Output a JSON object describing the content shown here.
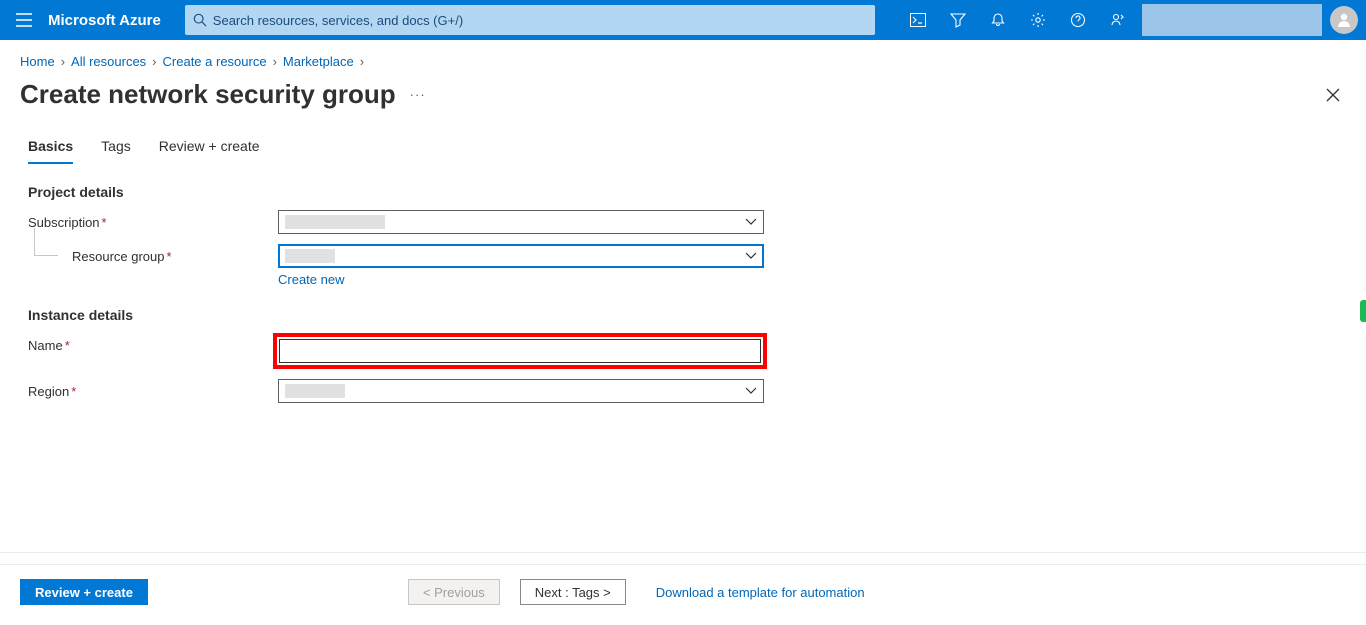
{
  "header": {
    "brand": "Microsoft Azure",
    "search_placeholder": "Search resources, services, and docs (G+/)"
  },
  "breadcrumb": {
    "items": [
      "Home",
      "All resources",
      "Create a resource",
      "Marketplace"
    ]
  },
  "page": {
    "title": "Create network security group",
    "more": "···"
  },
  "tabs": {
    "items": [
      {
        "label": "Basics",
        "active": true
      },
      {
        "label": "Tags",
        "active": false
      },
      {
        "label": "Review + create",
        "active": false
      }
    ]
  },
  "form": {
    "project_section": "Project details",
    "subscription_label": "Subscription",
    "resource_group_label": "Resource group",
    "create_new": "Create new",
    "instance_section": "Instance details",
    "name_label": "Name",
    "name_value": "",
    "region_label": "Region"
  },
  "footer": {
    "review": "Review + create",
    "previous": "< Previous",
    "next": "Next : Tags >",
    "download": "Download a template for automation"
  }
}
